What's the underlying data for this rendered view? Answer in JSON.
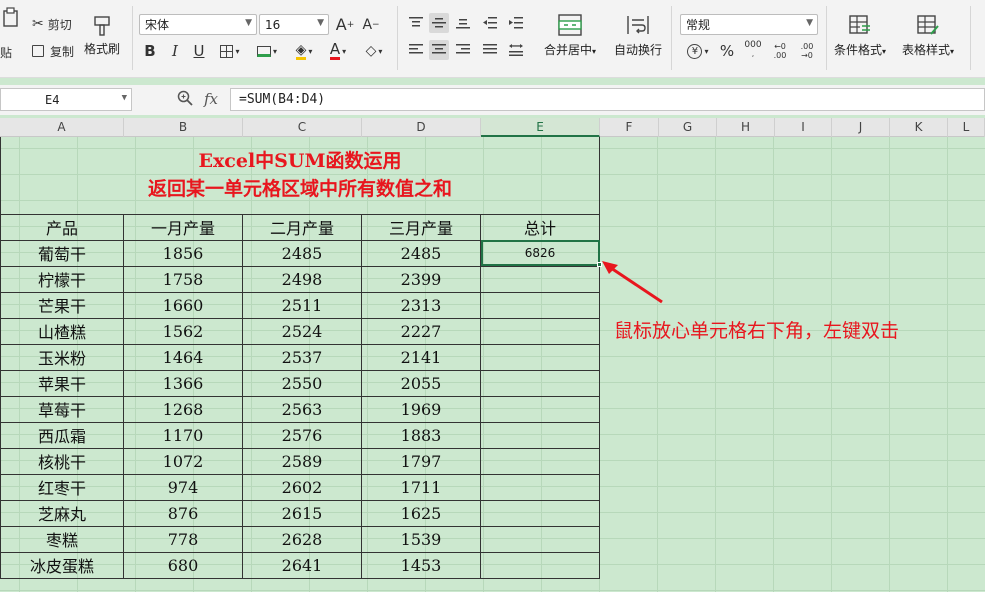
{
  "ribbon": {
    "paste_label": "贴",
    "cut_label": "剪切",
    "copy_label": "复制",
    "format_painter_label": "格式刷",
    "font_name": "宋体",
    "font_size": "16",
    "bold": "B",
    "italic": "I",
    "underline": "U",
    "font_color_glyph": "A",
    "merge_center_label": "合并居中",
    "wrap_text_label": "自动换行",
    "number_format": "常规",
    "percent_glyph": "%",
    "thousands_glyph": "000",
    "inc_decimal_glyph": "←0 .00",
    "dec_decimal_glyph": ".00 →0",
    "conditional_format_label": "条件格式",
    "table_style_label": "表格样式"
  },
  "formula_bar": {
    "name_box": "E4",
    "fx": "fx",
    "formula": "=SUM(B4:D4)"
  },
  "columns": [
    {
      "label": "A",
      "active": false
    },
    {
      "label": "B",
      "active": false
    },
    {
      "label": "C",
      "active": false
    },
    {
      "label": "D",
      "active": false
    },
    {
      "label": "E",
      "active": true
    },
    {
      "label": "F",
      "active": false
    },
    {
      "label": "G",
      "active": false
    },
    {
      "label": "H",
      "active": false
    },
    {
      "label": "I",
      "active": false
    },
    {
      "label": "J",
      "active": false
    },
    {
      "label": "K",
      "active": false
    },
    {
      "label": "L",
      "active": false
    }
  ],
  "sheet": {
    "title_line1": "Excel中SUM函数运用",
    "title_line2": "返回某一单元格区域中所有数值之和",
    "headers": [
      "产品",
      "一月产量",
      "二月产量",
      "三月产量",
      "总计"
    ],
    "rows": [
      [
        "葡萄干",
        "1856",
        "2485",
        "2485",
        "6826"
      ],
      [
        "柠檬干",
        "1758",
        "2498",
        "2399",
        ""
      ],
      [
        "芒果干",
        "1660",
        "2511",
        "2313",
        ""
      ],
      [
        "山楂糕",
        "1562",
        "2524",
        "2227",
        ""
      ],
      [
        "玉米粉",
        "1464",
        "2537",
        "2141",
        ""
      ],
      [
        "苹果干",
        "1366",
        "2550",
        "2055",
        ""
      ],
      [
        "草莓干",
        "1268",
        "2563",
        "1969",
        ""
      ],
      [
        "西瓜霜",
        "1170",
        "2576",
        "1883",
        ""
      ],
      [
        "核桃干",
        "1072",
        "2589",
        "1797",
        ""
      ],
      [
        "红枣干",
        "974",
        "2602",
        "1711",
        ""
      ],
      [
        "芝麻丸",
        "876",
        "2615",
        "1625",
        ""
      ],
      [
        "枣糕",
        "778",
        "2628",
        "1539",
        ""
      ],
      [
        "冰皮蛋糕",
        "680",
        "2641",
        "1453",
        ""
      ]
    ]
  },
  "annotation": {
    "text": "鼠标放心单元格右下角，左键双击",
    "color": "#e8161e"
  },
  "colors": {
    "title_red": "#e8161e",
    "selection_green": "#217346",
    "sheet_bg": "#cce8cf"
  }
}
